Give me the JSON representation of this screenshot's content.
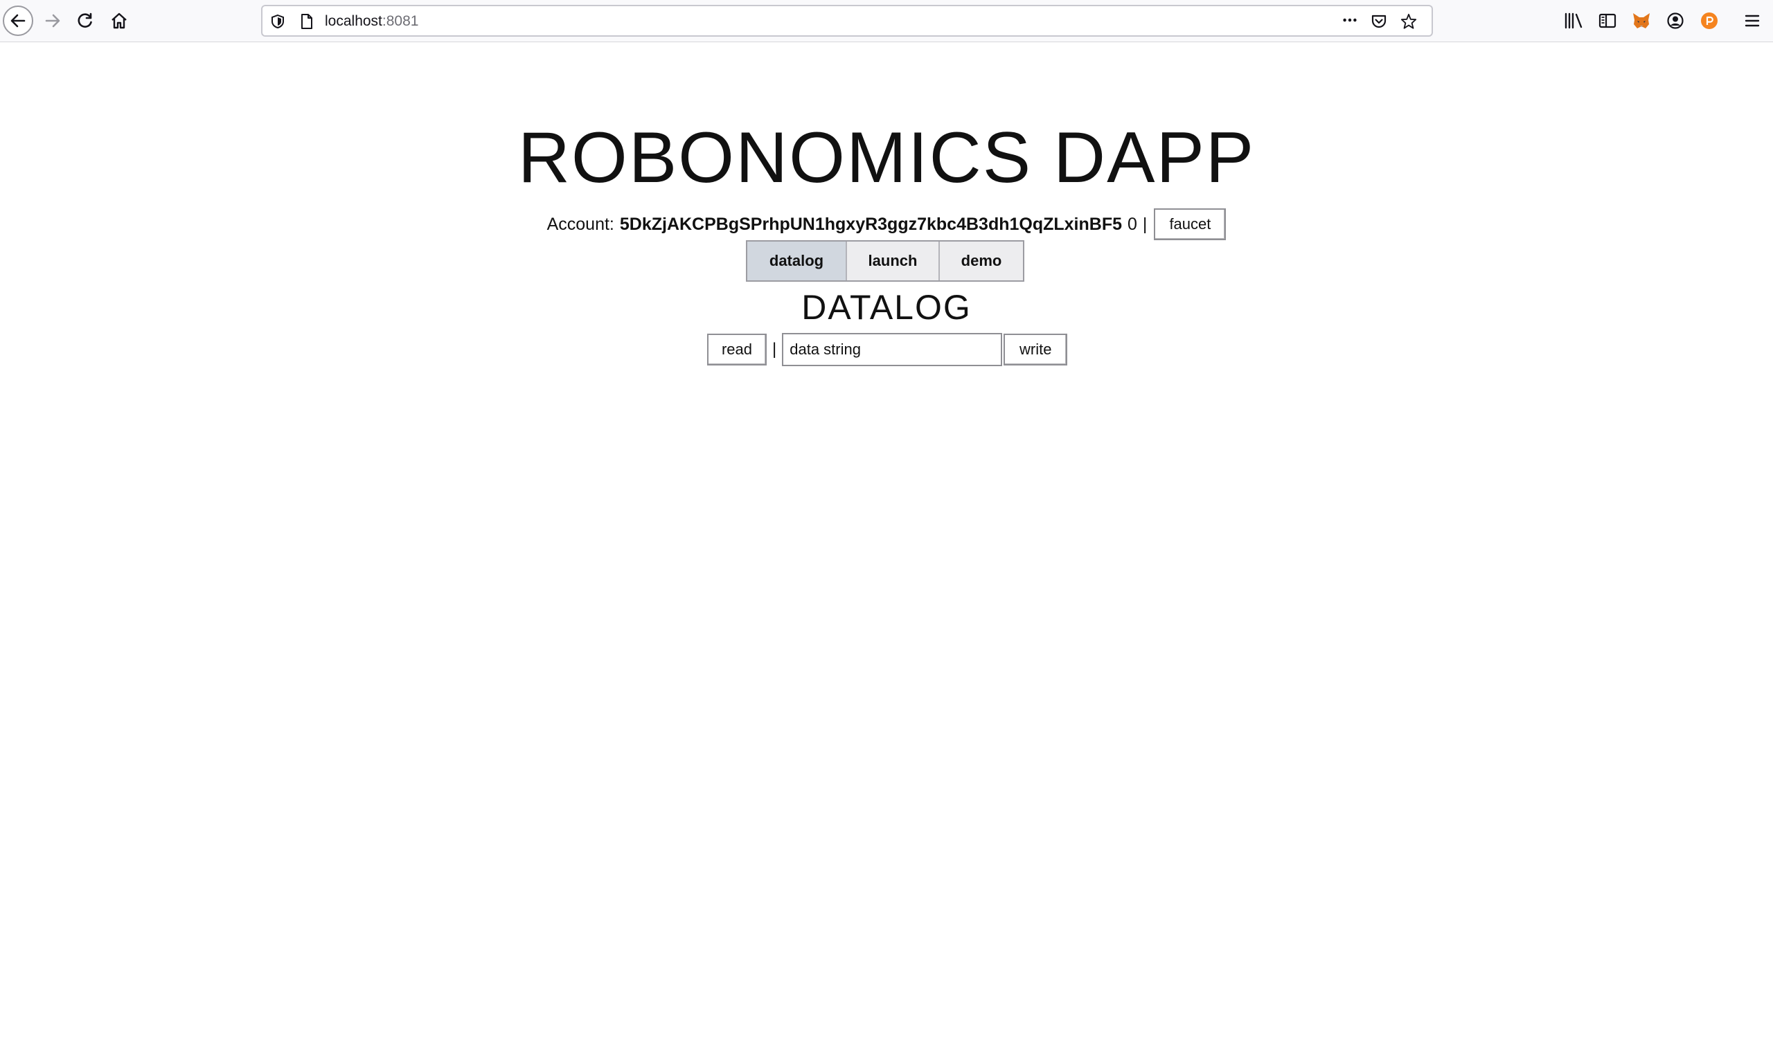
{
  "browser": {
    "url_host": "localhost",
    "url_port": ":8081"
  },
  "app": {
    "title": "ROBONOMICS DAPP",
    "account_label": "Account:",
    "account_address": "5DkZjAKCPBgSPrhpUN1hgxyR3ggz7kbc4B3dh1QqZLxinBF5",
    "account_balance": "0",
    "separator": "|",
    "faucet_label": "faucet"
  },
  "tabs": [
    {
      "label": "datalog",
      "active": true
    },
    {
      "label": "launch",
      "active": false
    },
    {
      "label": "demo",
      "active": false
    }
  ],
  "datalog": {
    "section_title": "DATALOG",
    "read_label": "read",
    "separator": "|",
    "input_value": "data string",
    "write_label": "write"
  },
  "colors": {
    "active_tab": "#d1d7df",
    "inactive_tab": "#ededef",
    "metamask_orange": "#e2761b",
    "ext_orange": "#f5841f"
  },
  "icons": {
    "back": "back-arrow-icon",
    "forward": "forward-arrow-icon",
    "reload": "reload-icon",
    "home": "home-icon",
    "shield": "shield-icon",
    "page": "page-icon",
    "more": "more-dots-icon",
    "pocket": "pocket-icon",
    "bookmark": "star-icon",
    "library": "library-icon",
    "sidebar": "sidebar-icon",
    "metamask": "fox-icon",
    "account": "account-icon",
    "extension": "extension-icon",
    "menu": "hamburger-menu-icon"
  }
}
